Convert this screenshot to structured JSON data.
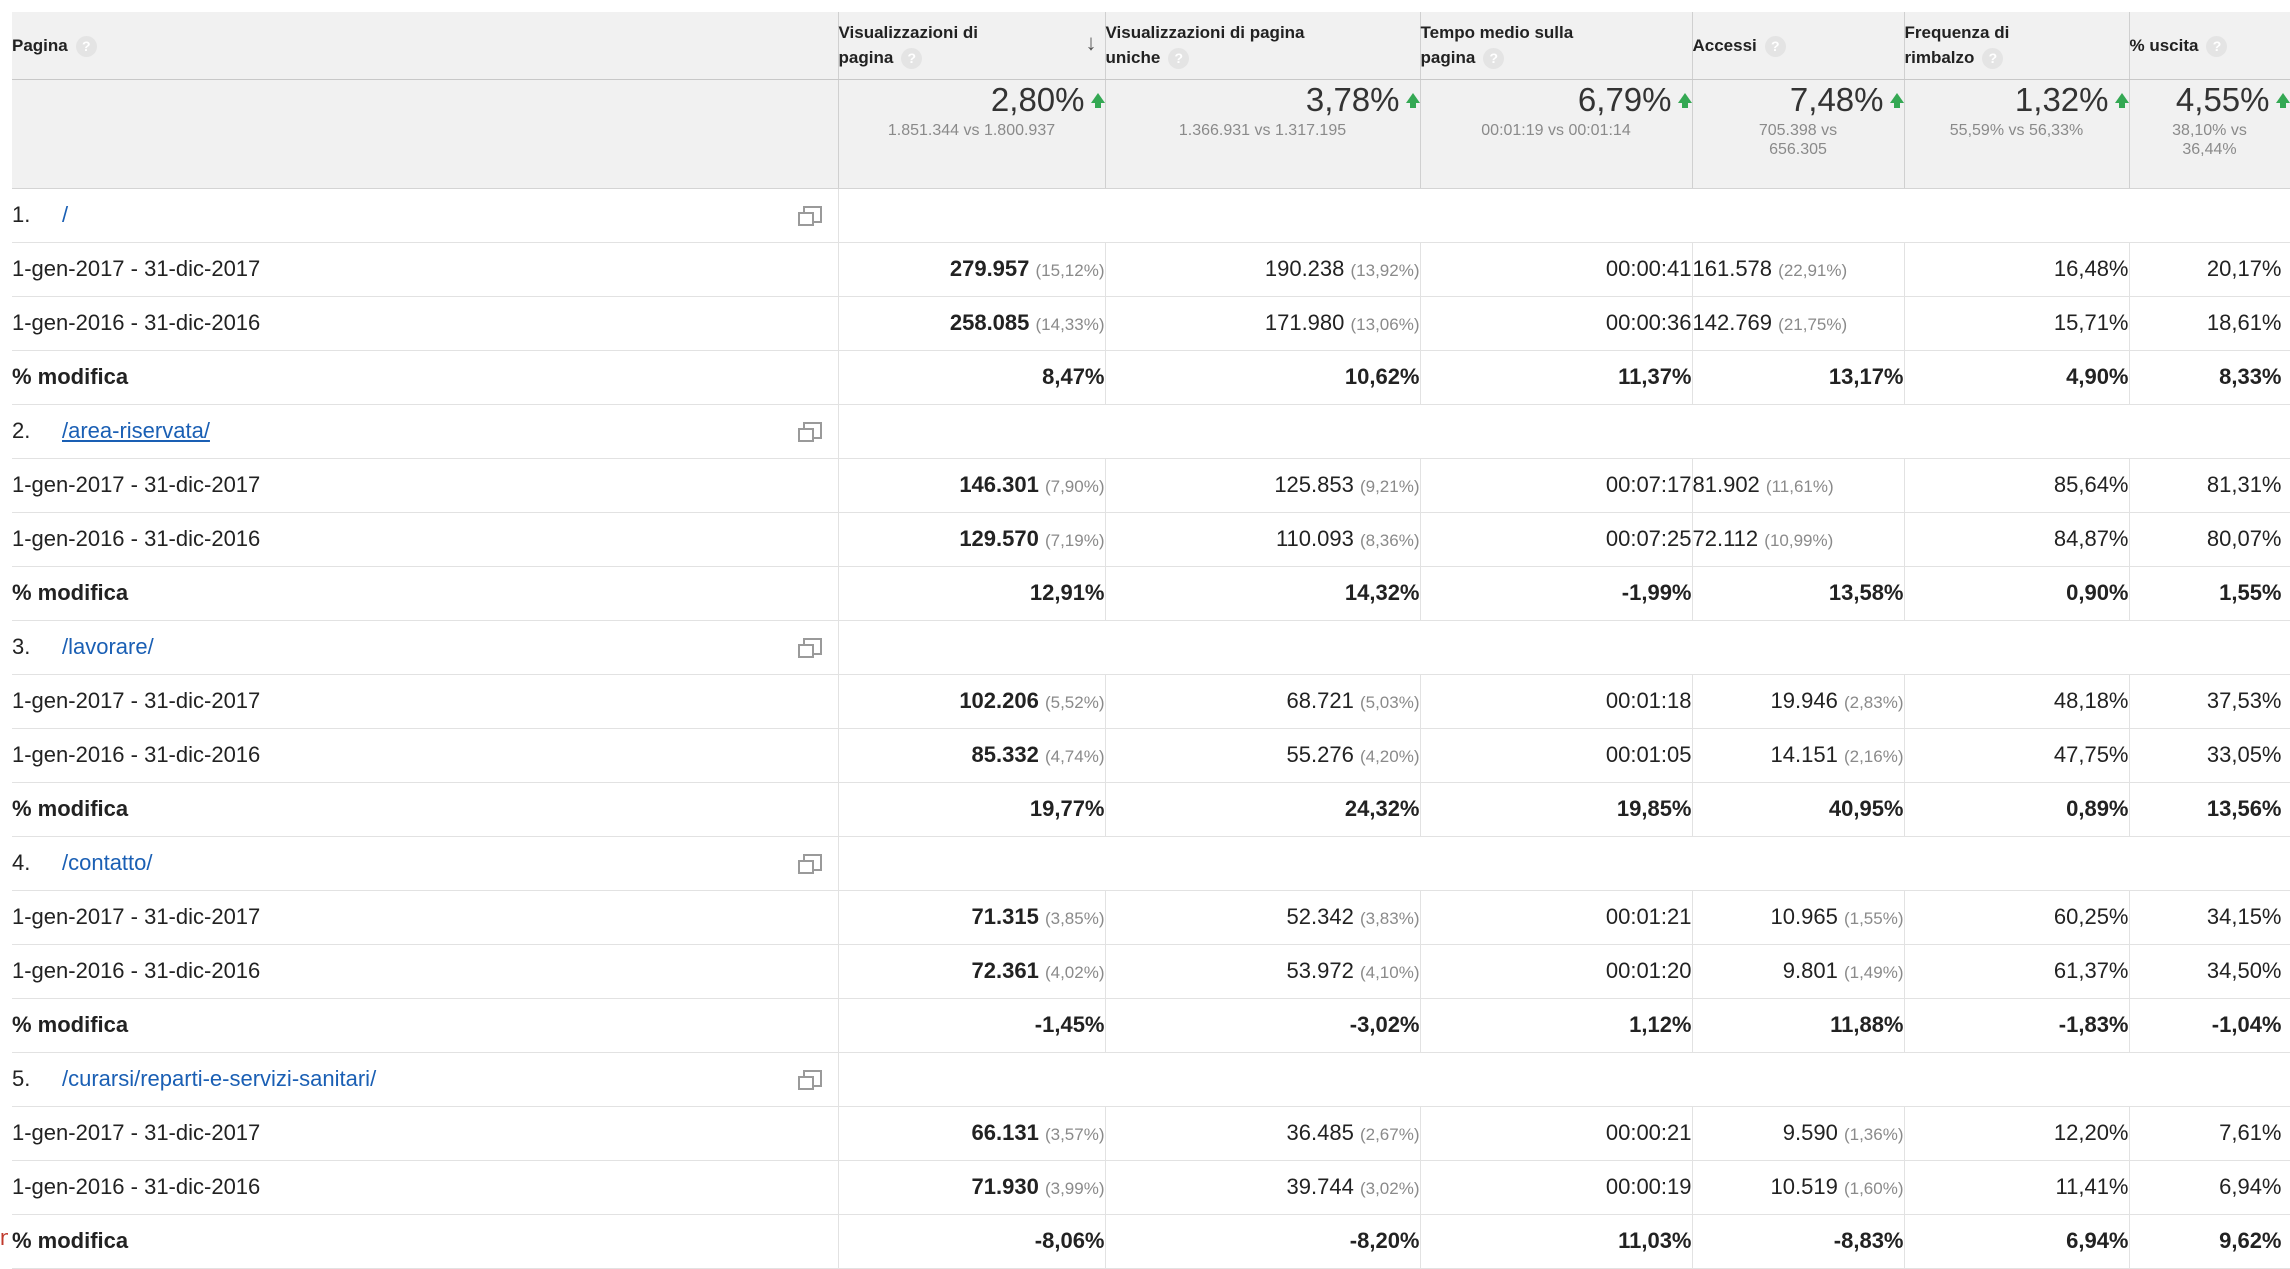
{
  "header": {
    "page": "Pagina",
    "pageviews": [
      "Visualizzazioni di",
      "pagina"
    ],
    "unique_pageviews": [
      "Visualizzazioni di pagina",
      "uniche"
    ],
    "avg_time": [
      "Tempo medio sulla",
      "pagina"
    ],
    "entrances": "Accessi",
    "bounce_rate": [
      "Frequenza di",
      "rimbalzo"
    ],
    "exit": "% uscita",
    "help": "?",
    "sort_arrow": "↓"
  },
  "summary": {
    "pageviews": {
      "pct": "2,80%",
      "sub": "1.851.344 vs 1.800.937"
    },
    "unique_pageviews": {
      "pct": "3,78%",
      "sub": "1.366.931 vs 1.317.195"
    },
    "avg_time": {
      "pct": "6,79%",
      "sub": "00:01:19 vs 00:01:14"
    },
    "entrances": {
      "pct": "7,48%",
      "sub1": "705.398 vs",
      "sub2": "656.305"
    },
    "bounce_rate": {
      "pct": "1,32%",
      "sub": "55,59% vs 56,33%"
    },
    "exit": {
      "pct": "4,55%",
      "sub1": "38,10% vs",
      "sub2": "36,44%"
    }
  },
  "labels": {
    "range_2017": "1-gen-2017 - 31-dic-2017",
    "range_2016": "1-gen-2016 - 31-dic-2016",
    "change": "% modifica"
  },
  "rows": [
    {
      "num": "1.",
      "page": "/",
      "y2017": {
        "pv": "279.957",
        "pv_pct": "(15,12%)",
        "upv": "190.238",
        "upv_pct": "(13,92%)",
        "time": "00:00:41",
        "acc": "161.578",
        "acc_pct": "(22,91%)",
        "bounce": "16,48%",
        "exit": "20,17%"
      },
      "y2016": {
        "pv": "258.085",
        "pv_pct": "(14,33%)",
        "upv": "171.980",
        "upv_pct": "(13,06%)",
        "time": "00:00:36",
        "acc": "142.769",
        "acc_pct": "(21,75%)",
        "bounce": "15,71%",
        "exit": "18,61%"
      },
      "chg": {
        "pv": "8,47%",
        "upv": "10,62%",
        "time": "11,37%",
        "acc": "13,17%",
        "bounce": "4,90%",
        "exit": "8,33%"
      }
    },
    {
      "num": "2.",
      "page": "/area-riservata/",
      "y2017": {
        "pv": "146.301",
        "pv_pct": "(7,90%)",
        "upv": "125.853",
        "upv_pct": "(9,21%)",
        "time": "00:07:17",
        "acc": "81.902",
        "acc_pct": "(11,61%)",
        "bounce": "85,64%",
        "exit": "81,31%"
      },
      "y2016": {
        "pv": "129.570",
        "pv_pct": "(7,19%)",
        "upv": "110.093",
        "upv_pct": "(8,36%)",
        "time": "00:07:25",
        "acc": "72.112",
        "acc_pct": "(10,99%)",
        "bounce": "84,87%",
        "exit": "80,07%"
      },
      "chg": {
        "pv": "12,91%",
        "upv": "14,32%",
        "time": "-1,99%",
        "acc": "13,58%",
        "bounce": "0,90%",
        "exit": "1,55%"
      }
    },
    {
      "num": "3.",
      "page": "/lavorare/",
      "y2017": {
        "pv": "102.206",
        "pv_pct": "(5,52%)",
        "upv": "68.721",
        "upv_pct": "(5,03%)",
        "time": "00:01:18",
        "acc": "19.946",
        "acc_pct": "(2,83%)",
        "bounce": "48,18%",
        "exit": "37,53%"
      },
      "y2016": {
        "pv": "85.332",
        "pv_pct": "(4,74%)",
        "upv": "55.276",
        "upv_pct": "(4,20%)",
        "time": "00:01:05",
        "acc": "14.151",
        "acc_pct": "(2,16%)",
        "bounce": "47,75%",
        "exit": "33,05%"
      },
      "chg": {
        "pv": "19,77%",
        "upv": "24,32%",
        "time": "19,85%",
        "acc": "40,95%",
        "bounce": "0,89%",
        "exit": "13,56%"
      }
    },
    {
      "num": "4.",
      "page": "/contatto/",
      "y2017": {
        "pv": "71.315",
        "pv_pct": "(3,85%)",
        "upv": "52.342",
        "upv_pct": "(3,83%)",
        "time": "00:01:21",
        "acc": "10.965",
        "acc_pct": "(1,55%)",
        "bounce": "60,25%",
        "exit": "34,15%"
      },
      "y2016": {
        "pv": "72.361",
        "pv_pct": "(4,02%)",
        "upv": "53.972",
        "upv_pct": "(4,10%)",
        "time": "00:01:20",
        "acc": "9.801",
        "acc_pct": "(1,49%)",
        "bounce": "61,37%",
        "exit": "34,50%"
      },
      "chg": {
        "pv": "-1,45%",
        "upv": "-3,02%",
        "time": "1,12%",
        "acc": "11,88%",
        "bounce": "-1,83%",
        "exit": "-1,04%"
      }
    },
    {
      "num": "5.",
      "page": "/curarsi/reparti-e-servizi-sanitari/",
      "y2017": {
        "pv": "66.131",
        "pv_pct": "(3,57%)",
        "upv": "36.485",
        "upv_pct": "(2,67%)",
        "time": "00:00:21",
        "acc": "9.590",
        "acc_pct": "(1,36%)",
        "bounce": "12,20%",
        "exit": "7,61%"
      },
      "y2016": {
        "pv": "71.930",
        "pv_pct": "(3,99%)",
        "upv": "39.744",
        "upv_pct": "(3,02%)",
        "time": "00:00:19",
        "acc": "10.519",
        "acc_pct": "(1,60%)",
        "bounce": "11,41%",
        "exit": "6,94%"
      },
      "chg": {
        "pv": "-8,06%",
        "upv": "-8,20%",
        "time": "11,03%",
        "acc": "-8,83%",
        "bounce": "6,94%",
        "exit": "9,62%"
      }
    }
  ],
  "colors": {
    "link": "#1a5fb4",
    "up_arrow": "#34a853",
    "header_bg": "#f1f1f1"
  },
  "edge_mark": "n"
}
